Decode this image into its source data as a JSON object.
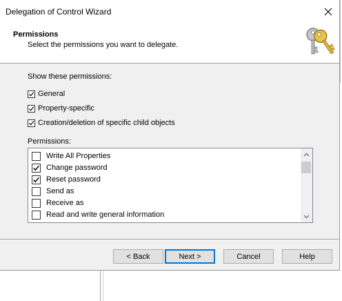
{
  "window": {
    "title": "Delegation of Control Wizard"
  },
  "header": {
    "title": "Permissions",
    "subtitle": "Select the permissions you want to delegate.",
    "icon": "keys-icon"
  },
  "show_permissions": {
    "label": "Show these permissions:",
    "options": [
      {
        "label": "General",
        "checked": true
      },
      {
        "label": "Property-specific",
        "checked": true
      },
      {
        "label": "Creation/deletion of specific child objects",
        "checked": true
      }
    ]
  },
  "permissions": {
    "label": "Permissions:",
    "items": [
      {
        "label": "Write All Properties",
        "checked": false
      },
      {
        "label": "Change password",
        "checked": true
      },
      {
        "label": "Reset password",
        "checked": true
      },
      {
        "label": "Send as",
        "checked": false
      },
      {
        "label": "Receive as",
        "checked": false
      },
      {
        "label": "Read and write general information",
        "checked": false
      }
    ]
  },
  "buttons": {
    "back": "< Back",
    "next": "Next >",
    "cancel": "Cancel",
    "help": "Help"
  },
  "colors": {
    "accent": "#0078d7",
    "dialog_bg": "#f0f0f0"
  }
}
